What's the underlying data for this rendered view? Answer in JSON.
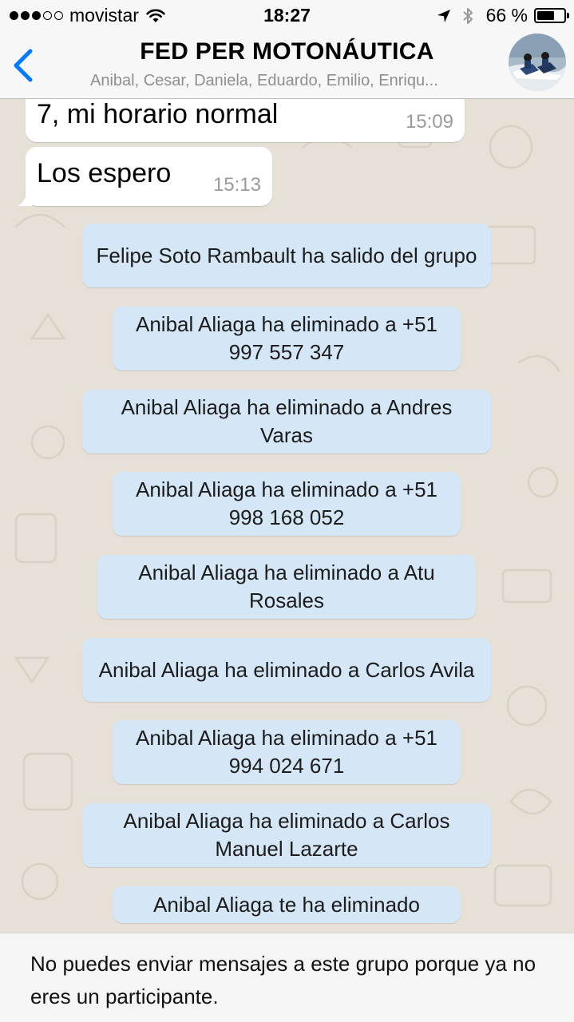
{
  "status_bar": {
    "carrier": "movistar",
    "time": "18:27",
    "battery_text": "66 %",
    "battery_level": 0.66,
    "signal_bars_filled": 3,
    "signal_bars_total": 5
  },
  "header": {
    "title": "FED PER MOTONÁUTICA",
    "subtitle": "Anibal, Cesar, Daniela, Eduardo, Emilio, Enriqu..."
  },
  "messages": [
    {
      "text": "7, mi horario normal",
      "time": "15:09"
    },
    {
      "text": "Los espero",
      "time": "15:13"
    }
  ],
  "system_messages": [
    "Felipe Soto Rambault ha salido del grupo",
    "Anibal Aliaga ha eliminado a +51 997 557 347",
    "Anibal Aliaga ha eliminado a Andres Varas",
    "Anibal Aliaga ha eliminado a +51 998 168 052",
    "Anibal Aliaga ha eliminado a Atu Rosales",
    "Anibal Aliaga ha eliminado a Carlos Avila",
    "Anibal Aliaga ha eliminado a +51 994 024 671",
    "Anibal Aliaga ha eliminado a Carlos Manuel Lazarte",
    "Anibal Aliaga te ha eliminado"
  ],
  "footer": {
    "notice": "No puedes enviar mensajes a este grupo porque ya no eres un participante."
  },
  "colors": {
    "accent": "#007aff",
    "system_bubble": "#d5e7f7",
    "incoming_bubble": "#ffffff",
    "chat_background": "#e7e0d6"
  },
  "icons": {
    "back": "chevron-left-icon",
    "wifi": "wifi-icon",
    "location": "location-arrow-icon",
    "bluetooth": "bluetooth-icon",
    "battery": "battery-icon"
  }
}
